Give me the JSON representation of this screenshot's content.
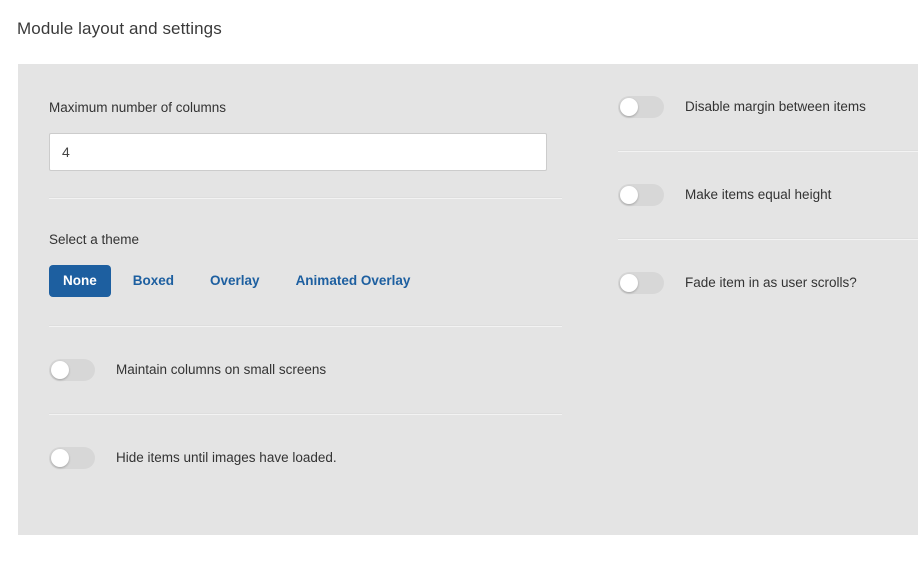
{
  "page": {
    "title": "Module layout and settings"
  },
  "colors": {
    "accent": "#1d5fa0",
    "panel_background": "#e4e4e4",
    "page_background": "#ffffff",
    "toggle_track_off": "#d7d7d7",
    "toggle_knob": "#ffffff",
    "label_text": "#333333"
  },
  "left_column": {
    "columns_field": {
      "label": "Maximum number of columns",
      "value": "4",
      "placeholder": ""
    },
    "theme_field": {
      "label": "Select a theme",
      "selected": "None",
      "options": [
        {
          "label": "None",
          "selected": true
        },
        {
          "label": "Boxed",
          "selected": false
        },
        {
          "label": "Overlay",
          "selected": false
        },
        {
          "label": "Animated Overlay",
          "selected": false
        }
      ]
    },
    "toggles": [
      {
        "label": "Maintain columns on small screens",
        "state": "off"
      },
      {
        "label": "Hide items until images have loaded.",
        "state": "off"
      }
    ]
  },
  "right_column": {
    "toggles": [
      {
        "label": "Disable margin between items",
        "state": "off"
      },
      {
        "label": "Make items equal height",
        "state": "off"
      },
      {
        "label": "Fade item in as user scrolls?",
        "state": "off"
      }
    ]
  }
}
